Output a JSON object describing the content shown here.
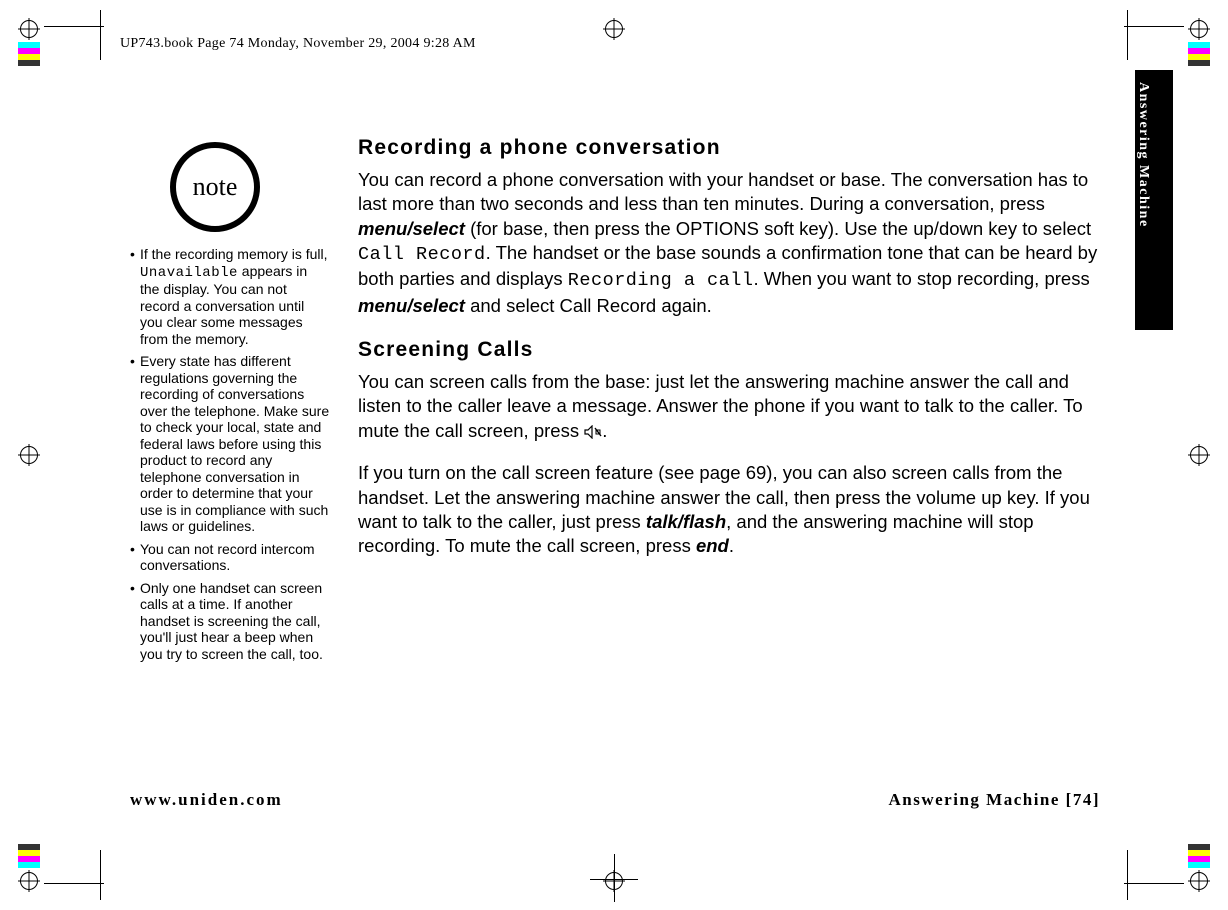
{
  "header": {
    "runner": "UP743.book  Page 74  Monday, November 29, 2004  9:28 AM"
  },
  "side_tab": {
    "label": "Answering Machine"
  },
  "note": {
    "badge": "note",
    "items": [
      {
        "pre": "If the recording memory is full, ",
        "mono": "Unavailable",
        "post": " appears in the display. You can not record a conversation until you clear some messages from the memory."
      },
      {
        "pre": "Every state has different regulations governing the recording of conversations over the telephone. Make sure to check your local, state and federal laws before using this product to record any telephone conversation in order to determine that your use is in compliance with such laws or guidelines.",
        "mono": "",
        "post": ""
      },
      {
        "pre": "You can not record intercom conversations.",
        "mono": "",
        "post": ""
      },
      {
        "pre": "Only one handset can screen calls at a time. If another handset is screening the call, you'll just hear a beep when you try to screen the call, too.",
        "mono": "",
        "post": ""
      }
    ]
  },
  "section1": {
    "title": "Recording a phone conversation",
    "p1a": "You can record a phone conversation with your handset or base. The conversation has to last more than two seconds and less than ten minutes. During a conversation, press ",
    "k1": "menu/select",
    "p1b": " (for base, then press the OPTIONS soft key). Use the up/down key to select ",
    "m1": "Call Record",
    "p1c": ". The handset or the base sounds a confirmation tone that can be heard by both parties and displays ",
    "m2": "Recording a call",
    "p1d": ". When you want to stop recording, press ",
    "k2": "menu/select",
    "p1e": " and select Call Record again."
  },
  "section2": {
    "title": "Screening Calls",
    "p1a": "You can screen calls from the base: just let the answering machine answer the call and listen to the caller leave a message. Answer the phone if you want to talk to the caller. To mute the call screen, press ",
    "p1b": ".",
    "p2a": "If you turn on the call screen feature (see page 69), you can also screen calls from the handset. Let the answering machine answer the call, then press the volume up key. If you want to talk to the caller, just press ",
    "k1": "talk/flash",
    "p2b": ", and the answering machine will stop recording. To mute the call screen, press ",
    "k2": "end",
    "p2c": "."
  },
  "footer": {
    "left": "www.uniden.com",
    "right": "Answering Machine [74]"
  }
}
